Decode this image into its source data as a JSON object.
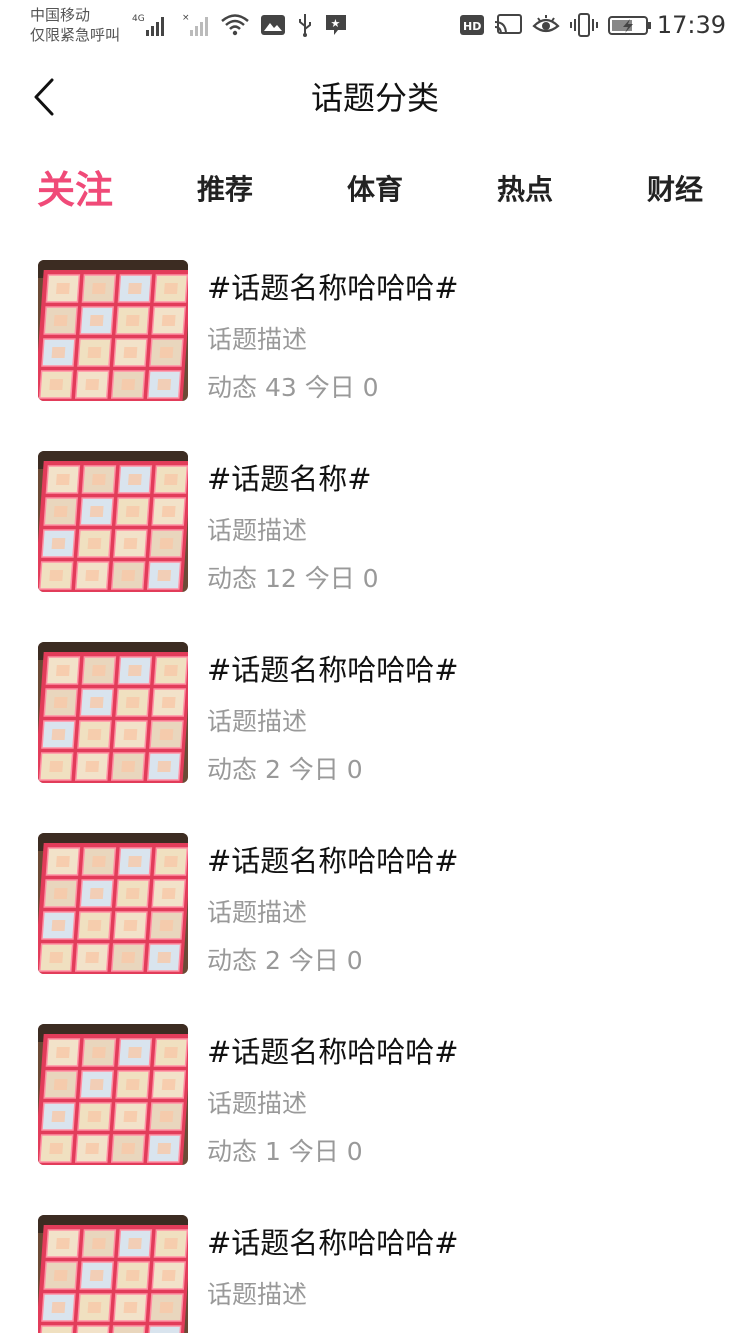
{
  "status_bar": {
    "carrier_line1": "中国移动",
    "carrier_line2": "仅限紧急呼叫",
    "network_label": "4G",
    "hd_label": "HD",
    "time": "17:39",
    "icons": [
      "signal-icon",
      "no-signal-icon",
      "wifi-icon",
      "image-icon",
      "usb-icon",
      "app-notification-icon",
      "hd-icon",
      "cast-icon",
      "eye-icon",
      "vibrate-icon",
      "battery-charging-icon"
    ]
  },
  "header": {
    "back_icon": "back-chevron-icon",
    "title": "话题分类"
  },
  "tabs": [
    {
      "label": "关注",
      "active": true
    },
    {
      "label": "推荐",
      "active": false
    },
    {
      "label": "体育",
      "active": false
    },
    {
      "label": "热点",
      "active": false
    },
    {
      "label": "财经",
      "active": false
    }
  ],
  "topics": [
    {
      "title": "#话题名称哈哈哈#",
      "description": "话题描述",
      "stats": "动态 43 今日 0"
    },
    {
      "title": "#话题名称#",
      "description": "话题描述",
      "stats": "动态 12 今日 0"
    },
    {
      "title": "#话题名称哈哈哈#",
      "description": "话题描述",
      "stats": "动态 2 今日 0"
    },
    {
      "title": "#话题名称哈哈哈#",
      "description": "话题描述",
      "stats": "动态 2 今日 0"
    },
    {
      "title": "#话题名称哈哈哈#",
      "description": "话题描述",
      "stats": "动态 1 今日 0"
    },
    {
      "title": "#话题名称哈哈哈#",
      "description": "话题描述",
      "stats": ""
    }
  ],
  "colors": {
    "accent": "#f04a78",
    "text_primary": "#111111",
    "text_secondary": "#999999",
    "tab_text": "#222222"
  }
}
